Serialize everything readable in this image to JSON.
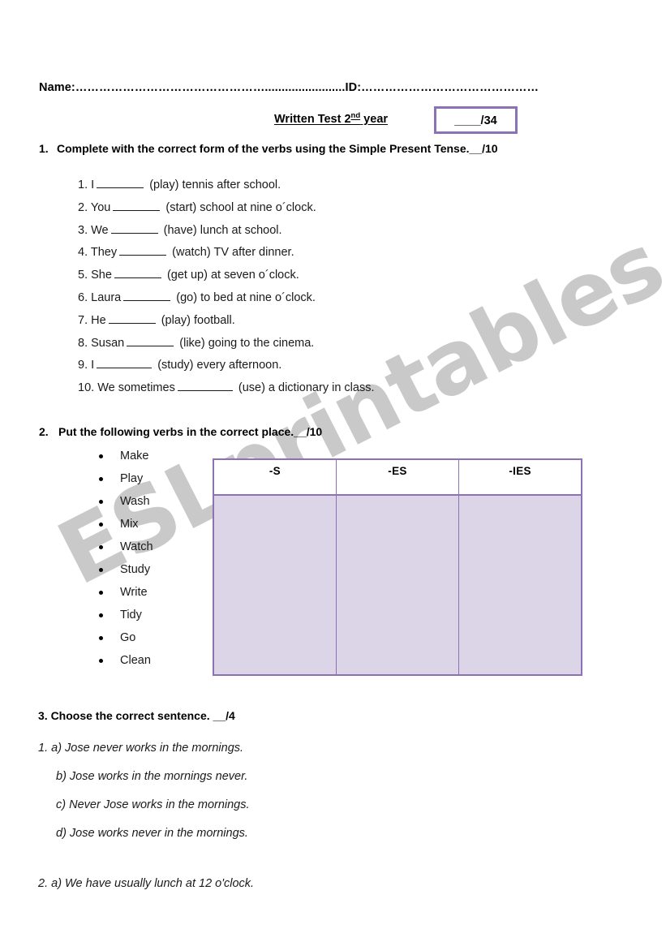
{
  "document": {
    "watermark": "ESLprintables.com",
    "accent_color": "#8c72b5",
    "table_fill_color": "#dcd5e8",
    "watermark_color": "#c9c9c9"
  },
  "header": {
    "name_line": "Name:…………………………………………........................ID:………………………………………",
    "title_main": "Written Test 2",
    "title_sup": "nd",
    "title_tail": " year",
    "score_box": "____/34"
  },
  "exercise1": {
    "number": "1.",
    "heading": "Complete with the correct form of the verbs using the Simple Present Tense.__/10",
    "items": [
      {
        "num": "1.",
        "before": "I",
        "after": "(play) tennis after school."
      },
      {
        "num": "2.",
        "before": "You",
        "after": "(start) school at nine o´clock."
      },
      {
        "num": "3.",
        "before": "We",
        "after": "(have) lunch at school."
      },
      {
        "num": "4.",
        "before": "They",
        "after": "(watch) TV after dinner."
      },
      {
        "num": "5.",
        "before": "She",
        "after": "(get up) at seven o´clock."
      },
      {
        "num": "6.",
        "before": "Laura",
        "after": "(go) to bed at nine o´clock."
      },
      {
        "num": "7.",
        "before": "He",
        "after": "(play) football."
      },
      {
        "num": "8.",
        "before": "Susan",
        "after": "(like) going to the cinema."
      },
      {
        "num": "9.",
        "before": "I",
        "after": "(study) every afternoon."
      },
      {
        "num": "10.",
        "before": "We sometimes",
        "after": "(use) a dictionary in class."
      }
    ]
  },
  "exercise2": {
    "number": "2.",
    "heading": "Put the following verbs in the correct place.__/10",
    "verbs": [
      "Make",
      "Play",
      "Wash",
      "Mix",
      "Watch",
      "Study",
      "Write",
      "Tidy",
      "Go",
      "Clean"
    ],
    "table": {
      "columns": [
        "-S",
        "-ES",
        "-IES"
      ],
      "rows": [
        [
          "",
          "",
          ""
        ]
      ]
    }
  },
  "exercise3": {
    "heading": "3. Choose the correct sentence. __/4",
    "questions": [
      {
        "number": "1.",
        "options": [
          "a) Jose never works in the mornings.",
          "b) Jose works in the mornings never.",
          "c) Never Jose works in the mornings.",
          "d) Jose works never in the mornings."
        ]
      },
      {
        "number": "2.",
        "options": [
          "a) We have usually lunch at 12 o'clock."
        ]
      }
    ]
  }
}
